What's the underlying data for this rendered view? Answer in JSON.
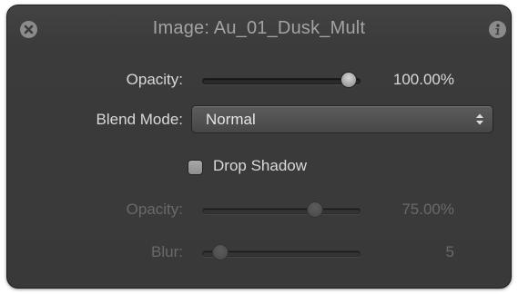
{
  "panel": {
    "title": "Image: Au_01_Dusk_Mult",
    "close_icon": "close-circle-icon",
    "info_icon": "info-circle-icon"
  },
  "opacity": {
    "label": "Opacity:",
    "value_text": "100.00%",
    "level": 1.0
  },
  "blend_mode": {
    "label": "Blend Mode:",
    "selected": "Normal",
    "arrows_icon": "up-down-chevrons-icon"
  },
  "drop_shadow": {
    "label": "Drop Shadow",
    "checked": false
  },
  "shadow_opacity": {
    "label": "Opacity:",
    "value_text": "75.00%",
    "level": 0.75,
    "enabled": false
  },
  "shadow_blur": {
    "label": "Blur:",
    "value_text": "5",
    "level": 0.05,
    "enabled": false
  }
}
